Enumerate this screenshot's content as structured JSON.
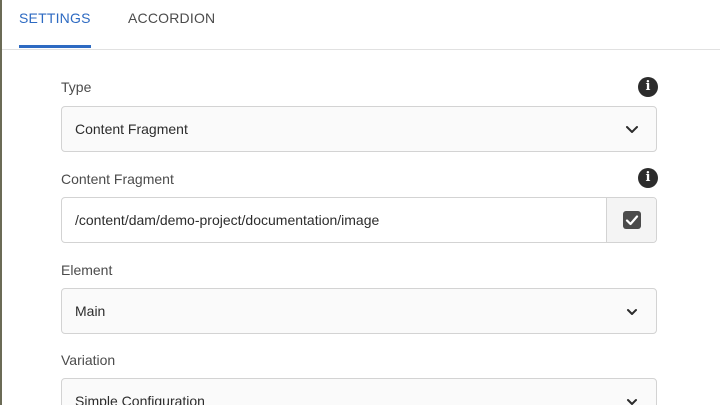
{
  "tabs": [
    {
      "label": "SETTINGS",
      "active": true
    },
    {
      "label": "ACCORDION",
      "active": false
    }
  ],
  "colors": {
    "accent": "#2d6ac2",
    "text": "#4b4b4b",
    "border": "#d3d3d3"
  },
  "fields": {
    "type": {
      "label": "Type",
      "value": "Content Fragment",
      "icon": "info-icon"
    },
    "content_fragment": {
      "label": "Content Fragment",
      "value": "/content/dam/demo-project/documentation/image",
      "icon": "info-icon",
      "button_icon": "checkbox-check-icon"
    },
    "element": {
      "label": "Element",
      "value": "Main"
    },
    "variation": {
      "label": "Variation",
      "value": "Simple Configuration"
    }
  }
}
